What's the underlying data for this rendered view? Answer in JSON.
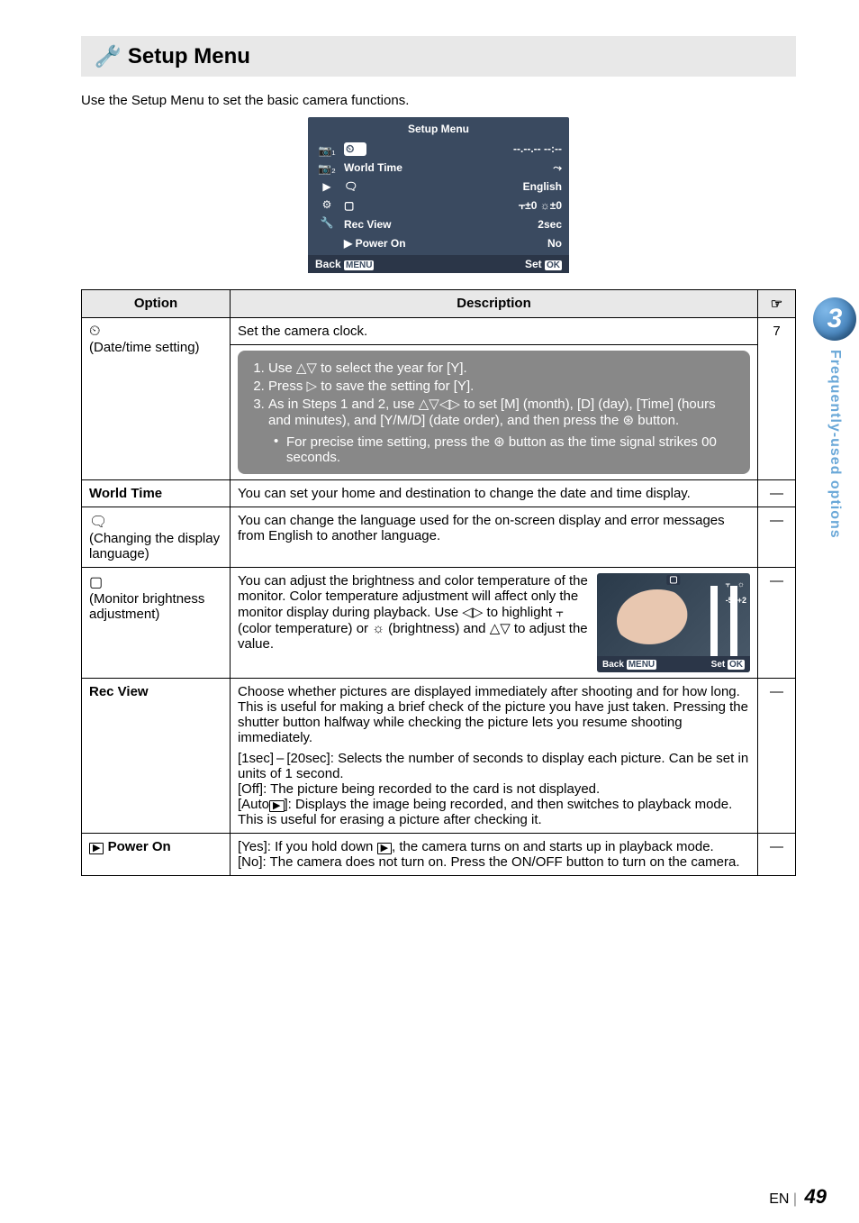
{
  "page": {
    "title": "Setup Menu",
    "intro": "Use the Setup Menu to set the basic camera functions."
  },
  "side": {
    "chapter": "3",
    "label": "Frequently-used options"
  },
  "footer": {
    "lang": "EN",
    "page": "49"
  },
  "setupbox": {
    "title": "Setup Menu",
    "clock_val": "--.--.-- --:--",
    "world": "World Time",
    "world_icon": "⤳",
    "lang_val": "English",
    "monitor_val": "⫟±0 ☼±0",
    "rec": "Rec View",
    "rec_val": "2sec",
    "power": "▶ Power On",
    "power_val": "No",
    "back": "Back",
    "back_btn": "MENU",
    "set": "Set",
    "set_btn": "OK",
    "left_icons": [
      "📷₁",
      "📷₂",
      "▶",
      "⚙",
      "🔧"
    ],
    "clock_icon": "⏲",
    "lang_icon": "🗨",
    "monitor_icon": "▢"
  },
  "thumb": {
    "title": "▢",
    "scale_top1": "⫟",
    "scale_top2": "☼",
    "label_left": "-5",
    "label_right": "+2",
    "back": "Back",
    "back_btn": "MENU",
    "set": "Set",
    "set_btn": "OK"
  },
  "headers": {
    "option": "Option",
    "description": "Description",
    "ref": "☞"
  },
  "rows": {
    "clock": {
      "opt_icon": "⏲",
      "opt_sub": "(Date/time setting)",
      "desc_top": "Set the camera clock.",
      "step1": "Use △▽ to select the year for [Y].",
      "step2": "Press ▷ to save the setting for [Y].",
      "step3": "As in Steps 1 and 2, use △▽◁▷ to set [M] (month), [D] (day), [Time] (hours and minutes), and [Y/M/D] (date order), and then press the ⊛ button.",
      "bullet": "For precise time setting, press the ⊛ button as the time signal strikes 00 seconds.",
      "ref": "7"
    },
    "world": {
      "opt": "World Time",
      "desc": "You can set your home and destination to change the date and time display.",
      "ref": "—"
    },
    "lang": {
      "opt_icon": "🗨",
      "opt_sub": "(Changing the display language)",
      "desc": "You can change the language used for the on-screen display and error messages from English to another language.",
      "ref": "—"
    },
    "mon": {
      "opt_icon": "▢",
      "opt_sub": "(Monitor brightness adjustment)",
      "desc": "You can adjust the brightness and color temperature of the monitor. Color temperature adjustment will affect only the monitor display during playback. Use ◁▷ to highlight ⫟ (color temperature) or ☼ (brightness) and △▽ to adjust the value.",
      "ref": "—"
    },
    "rec": {
      "opt": "Rec View",
      "desc1": "Choose whether pictures are displayed immediately after shooting and for how long. This is useful for making a brief check of the picture you have just taken. Pressing the shutter button halfway while checking the picture lets you resume shooting immediately.",
      "desc2a": "[1sec] – [20sec]: Selects the number of seconds to display each picture. Can be set in units of 1 second.",
      "desc2b": "[Off]: The picture being recorded to the card is not displayed.",
      "desc2c_pre": "[Auto",
      "desc2c_post": "]:  Displays the image being recorded, and then switches to playback mode. This is useful for erasing a picture after checking it.",
      "ref": "—"
    },
    "power": {
      "opt": "Power On",
      "desc1_pre": "[Yes]: If you hold down ",
      "desc1_post": ", the camera turns on and starts up in playback mode.",
      "desc2": "[No]: The camera does not turn on. Press the ON/OFF button to turn on the camera.",
      "ref": "—"
    }
  }
}
